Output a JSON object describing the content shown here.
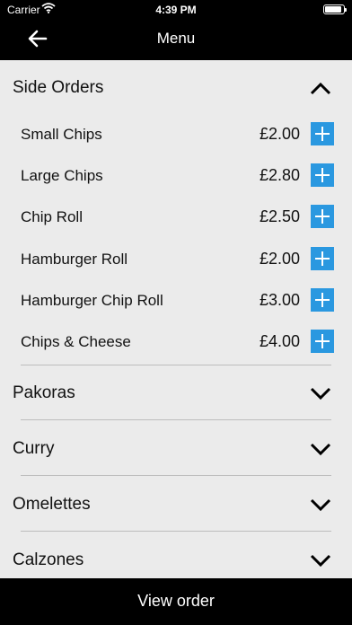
{
  "status": {
    "carrier": "Carrier",
    "time": "4:39 PM"
  },
  "header": {
    "title": "Menu",
    "back_icon": "arrow-left-icon"
  },
  "categories": [
    {
      "label": "Side Orders",
      "expanded": true
    },
    {
      "label": "Pakoras",
      "expanded": false
    },
    {
      "label": "Curry",
      "expanded": false
    },
    {
      "label": "Omelettes",
      "expanded": false
    },
    {
      "label": "Calzones",
      "expanded": false
    }
  ],
  "items": [
    {
      "name": "Small Chips",
      "price": "£2.00"
    },
    {
      "name": "Large Chips",
      "price": "£2.80"
    },
    {
      "name": "Chip Roll",
      "price": "£2.50"
    },
    {
      "name": "Hamburger Roll",
      "price": "£2.00"
    },
    {
      "name": "Hamburger Chip Roll",
      "price": "£3.00"
    },
    {
      "name": "Chips & Cheese",
      "price": "£4.00"
    }
  ],
  "footer": {
    "label": "View order"
  },
  "colors": {
    "bar": "#000000",
    "background": "#ebebeb",
    "add_button": "#2a98e0"
  }
}
